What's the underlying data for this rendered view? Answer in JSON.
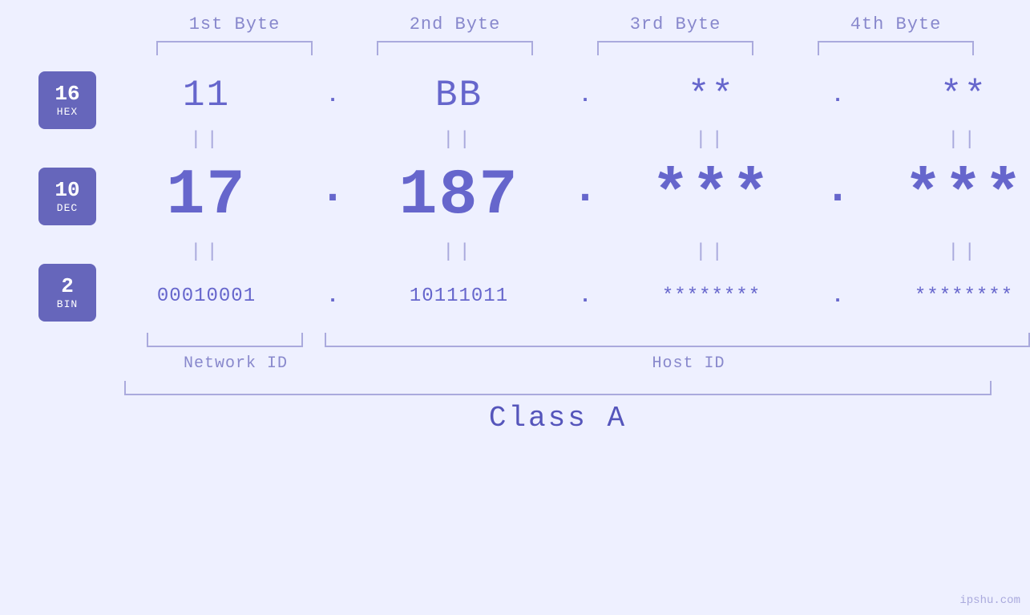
{
  "headers": {
    "byte1": "1st Byte",
    "byte2": "2nd Byte",
    "byte3": "3rd Byte",
    "byte4": "4th Byte"
  },
  "badges": {
    "hex": {
      "num": "16",
      "label": "HEX"
    },
    "dec": {
      "num": "10",
      "label": "DEC"
    },
    "bin": {
      "num": "2",
      "label": "BIN"
    }
  },
  "values": {
    "hex": {
      "b1": "11",
      "b2": "BB",
      "b3": "**",
      "b4": "**"
    },
    "dec": {
      "b1": "17",
      "b2": "187",
      "b3": "***",
      "b4": "***"
    },
    "bin": {
      "b1": "00010001",
      "b2": "10111011",
      "b3": "********",
      "b4": "********"
    }
  },
  "labels": {
    "network_id": "Network ID",
    "host_id": "Host ID",
    "class": "Class A"
  },
  "watermark": "ipshu.com",
  "equals_sign": "||"
}
